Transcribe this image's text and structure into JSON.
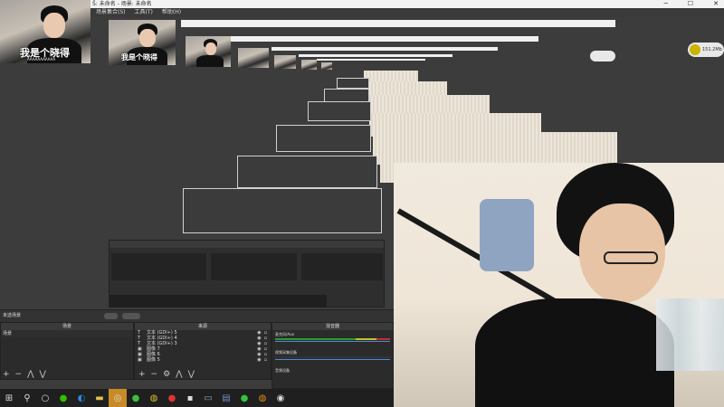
{
  "window": {
    "title": "Ŝ: 未命名 - 场景: 未命名",
    "controls": [
      "─",
      "☐",
      "✕"
    ],
    "menu": [
      "场景集合(S)",
      "工具(T)",
      "帮助(H)"
    ]
  },
  "webcam": {
    "subtitle": "我是个晓得",
    "subtitle_small": "我是个晓得",
    "caption_tiny": "AAAAAAAAAAA"
  },
  "network": {
    "speed": "151.2Mb",
    "icon": "network-status-icon"
  },
  "panels": {
    "scenes_header": "未选场景",
    "scene_col": "场景",
    "sources_col": "来源",
    "mixer_col": "混音器",
    "scene_item": "场景",
    "sources": [
      {
        "icon": "text-icon",
        "label": "文本 (GDI+) 5"
      },
      {
        "icon": "text-icon",
        "label": "文本 (GDI+) 4"
      },
      {
        "icon": "text-icon",
        "label": "文本 (GDI+) 3"
      },
      {
        "icon": "image-icon",
        "label": "图像 7"
      },
      {
        "icon": "image-icon",
        "label": "图像 6"
      },
      {
        "icon": "image-icon",
        "label": "图像 5"
      }
    ],
    "mixer": [
      {
        "label": "桌面音频 1"
      },
      {
        "label": "麦克风/Aux"
      },
      {
        "label": "视频采集设备"
      }
    ],
    "mixer_bottom": "音频设备",
    "toggles": [
      "",
      ""
    ]
  },
  "taskbar": {
    "icons": [
      "windows-start-icon",
      "search-icon",
      "task-view-icon",
      "wechat-icon",
      "edge-icon",
      "explorer-icon",
      "steam-icon",
      "app-green-icon",
      "app-yellow-icon",
      "netease-music-icon",
      "app-dark-icon",
      "app-monitor-icon",
      "app-store-icon",
      "wechat-green-icon",
      "app-orange-icon",
      "obs-icon"
    ]
  },
  "colors": {
    "taskbar_active": "#c98a25",
    "meter_green": "#1e8a1e",
    "bg": "#3c3c3c"
  }
}
